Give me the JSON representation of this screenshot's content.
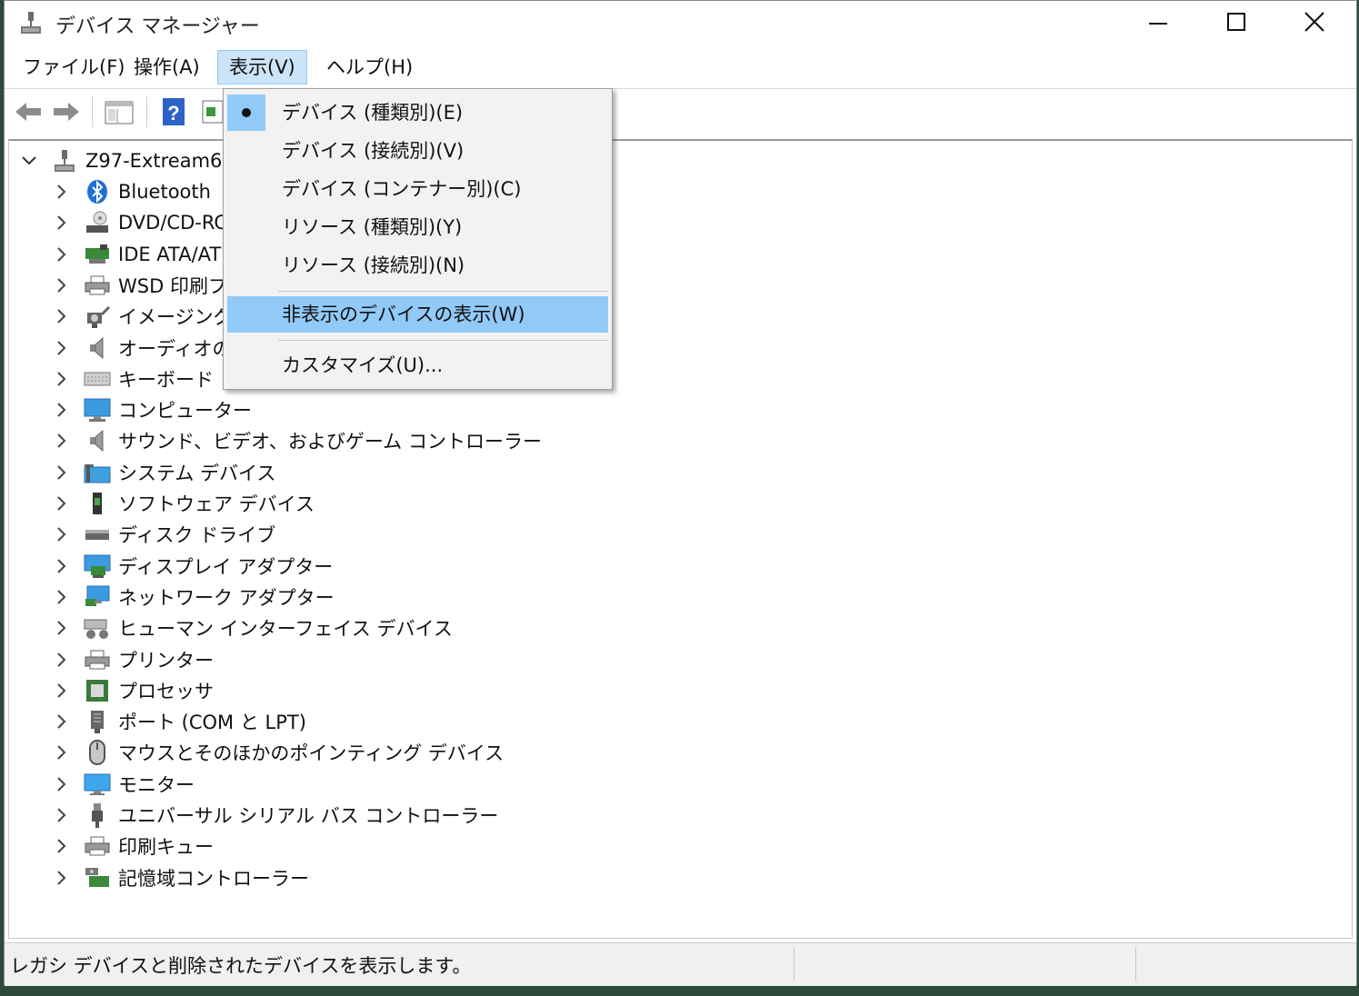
{
  "window": {
    "title": "デバイス マネージャー"
  },
  "menubar": {
    "items": [
      "ファイル(F)",
      "操作(A)",
      "表示(V)",
      "ヘルプ(H)"
    ]
  },
  "view_menu": {
    "items": [
      {
        "label": "デバイス (種類別)(E)",
        "checked": true
      },
      {
        "label": "デバイス (接続別)(V)"
      },
      {
        "label": "デバイス (コンテナー別)(C)"
      },
      {
        "label": "リソース (種類別)(Y)"
      },
      {
        "label": "リソース (接続別)(N)"
      },
      {
        "label": "非表示のデバイスの表示(W)",
        "highlighted": true
      },
      {
        "label": "カスタマイズ(U)..."
      }
    ]
  },
  "tree": {
    "root": "Z97-Extream6",
    "categories": [
      {
        "label": "Bluetooth",
        "icon": "bluetooth-icon"
      },
      {
        "label": "DVD/CD-RC",
        "icon": "dvd-drive-icon"
      },
      {
        "label": "IDE ATA/AT",
        "icon": "ide-controller-icon"
      },
      {
        "label": "WSD 印刷プ",
        "icon": "printer-icon"
      },
      {
        "label": "イメージング デ",
        "icon": "camera-icon"
      },
      {
        "label": "オーディオの入",
        "icon": "speaker-icon"
      },
      {
        "label": "キーボード",
        "icon": "keyboard-icon"
      },
      {
        "label": "コンピューター",
        "icon": "computer-icon"
      },
      {
        "label": "サウンド、ビデオ、およびゲーム コントローラー",
        "icon": "speaker-icon"
      },
      {
        "label": "システム デバイス",
        "icon": "system-folder-icon"
      },
      {
        "label": "ソフトウェア デバイス",
        "icon": "software-device-icon"
      },
      {
        "label": "ディスク ドライブ",
        "icon": "disk-drive-icon"
      },
      {
        "label": "ディスプレイ アダプター",
        "icon": "display-adapter-icon"
      },
      {
        "label": "ネットワーク アダプター",
        "icon": "network-adapter-icon"
      },
      {
        "label": "ヒューマン インターフェイス デバイス",
        "icon": "hid-icon"
      },
      {
        "label": "プリンター",
        "icon": "printer-icon"
      },
      {
        "label": "プロセッサ",
        "icon": "processor-icon"
      },
      {
        "label": "ポート (COM と LPT)",
        "icon": "port-icon"
      },
      {
        "label": "マウスとそのほかのポインティング デバイス",
        "icon": "mouse-icon"
      },
      {
        "label": "モニター",
        "icon": "monitor-icon"
      },
      {
        "label": "ユニバーサル シリアル バス コントローラー",
        "icon": "usb-icon"
      },
      {
        "label": "印刷キュー",
        "icon": "printer-icon"
      },
      {
        "label": "記憶域コントローラー",
        "icon": "storage-controller-icon"
      }
    ]
  },
  "statusbar": {
    "text": "レガシ デバイスと削除されたデバイスを表示します。"
  },
  "colors": {
    "menu_highlight": "#91c9f7",
    "menu_active_bg": "#cce4f7",
    "statusbar_bg": "#f0f0f0"
  }
}
